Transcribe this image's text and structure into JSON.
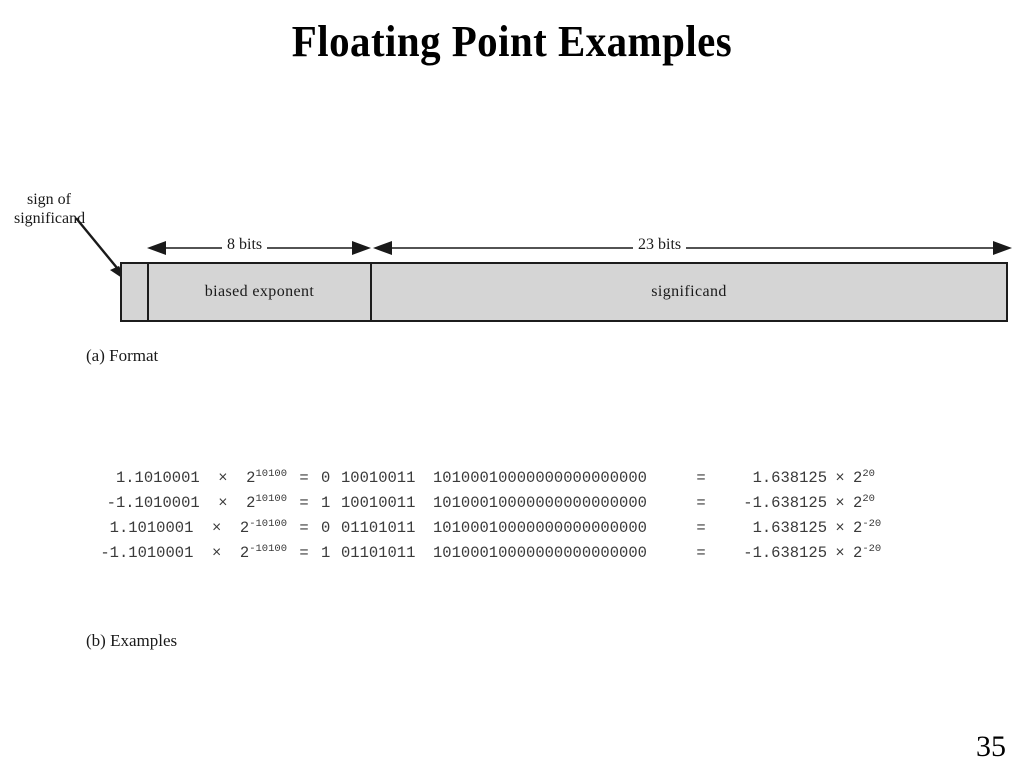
{
  "slide": {
    "title": "Floating Point Examples",
    "page_number": "35"
  },
  "format_figure": {
    "caption": "(a) Format",
    "callout": {
      "line1": "sign of",
      "line2": "significand"
    },
    "dimensions": {
      "exponent_bits": "8 bits",
      "significand_bits": "23 bits"
    },
    "fields": {
      "sign": "",
      "exponent": "biased exponent",
      "significand": "significand"
    },
    "colors": {
      "field_fill": "#d5d5d5",
      "field_border": "#1c1c1c"
    }
  },
  "examples_figure": {
    "caption": "(b) Examples",
    "rows": [
      {
        "left_mantissa": "1.1010001",
        "left_times": "×",
        "left_base": "2",
        "left_exponent": "10100",
        "equals": "=",
        "sign_bit": "0",
        "exponent_bits": "10010011",
        "significand_bits": "10100010000000000000000",
        "equals2": "=",
        "value": "1.638125",
        "value_times": "×",
        "value_base": "2",
        "value_exponent": "20"
      },
      {
        "left_mantissa": "-1.1010001",
        "left_times": "×",
        "left_base": "2",
        "left_exponent": "10100",
        "equals": "=",
        "sign_bit": "1",
        "exponent_bits": "10010011",
        "significand_bits": "10100010000000000000000",
        "equals2": "=",
        "value": "-1.638125",
        "value_times": "×",
        "value_base": "2",
        "value_exponent": "20"
      },
      {
        "left_mantissa": "1.1010001",
        "left_times": "×",
        "left_base": "2",
        "left_exponent": "-10100",
        "equals": "=",
        "sign_bit": "0",
        "exponent_bits": "01101011",
        "significand_bits": "10100010000000000000000",
        "equals2": "=",
        "value": "1.638125",
        "value_times": "×",
        "value_base": "2",
        "value_exponent": "-20"
      },
      {
        "left_mantissa": "-1.1010001",
        "left_times": "×",
        "left_base": "2",
        "left_exponent": "-10100",
        "equals": "=",
        "sign_bit": "1",
        "exponent_bits": "01101011",
        "significand_bits": "10100010000000000000000",
        "equals2": "=",
        "value": "-1.638125",
        "value_times": "×",
        "value_base": "2",
        "value_exponent": "-20"
      }
    ]
  }
}
